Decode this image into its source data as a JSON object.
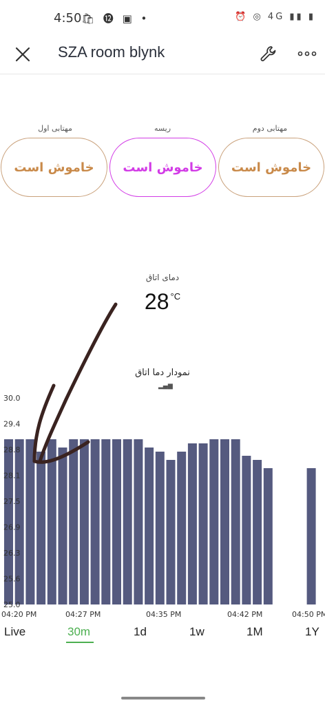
{
  "status_bar": {
    "time": "4:50",
    "left_icons": "🛍 ⓬ ▣ •",
    "right_icons": "⏰ ◎ 4G ▮▮ ▮"
  },
  "app_bar": {
    "title": "SZA room blynk",
    "close_icon": "close-icon",
    "settings_icon": "wrench-icon",
    "more_icon": "more-icon"
  },
  "switches": [
    {
      "label": "مهتابی اول",
      "state": "خاموش است",
      "color": "#c98a4a"
    },
    {
      "label": "ریسه",
      "state": "خاموش است",
      "color": "#d23be6"
    },
    {
      "label": "مهتابی دوم",
      "state": "خاموش است",
      "color": "#c98a4a"
    }
  ],
  "temperature": {
    "label": "دمای اتاق",
    "value": "28",
    "unit": "°C"
  },
  "chart_title": "نمودار دما اتاق",
  "chart_data": {
    "type": "bar",
    "title": "نمودار دما اتاق",
    "y_ticks": [
      "30.0",
      "29.4",
      "28.8",
      "28.1",
      "27.5",
      "26.9",
      "26.3",
      "25.6",
      "25.0"
    ],
    "ylim": [
      25.0,
      30.0
    ],
    "x_ticks": [
      "04:20 PM",
      "04:27 PM",
      "04:35 PM",
      "04:42 PM",
      "04:50 PM"
    ],
    "values": [
      29.0,
      29.0,
      29.0,
      28.7,
      29.0,
      28.8,
      29.0,
      29.0,
      29.0,
      29.0,
      29.0,
      29.0,
      29.0,
      28.8,
      28.7,
      28.5,
      28.7,
      28.9,
      28.9,
      29.0,
      29.0,
      29.0,
      28.6,
      28.5,
      28.3,
      null,
      null,
      null,
      28.3
    ],
    "bar_color": "#555a7f",
    "grid": false
  },
  "periods": {
    "items": [
      "Live",
      "30m",
      "1d",
      "1w",
      "1M",
      "1Y"
    ],
    "active": "30m"
  }
}
